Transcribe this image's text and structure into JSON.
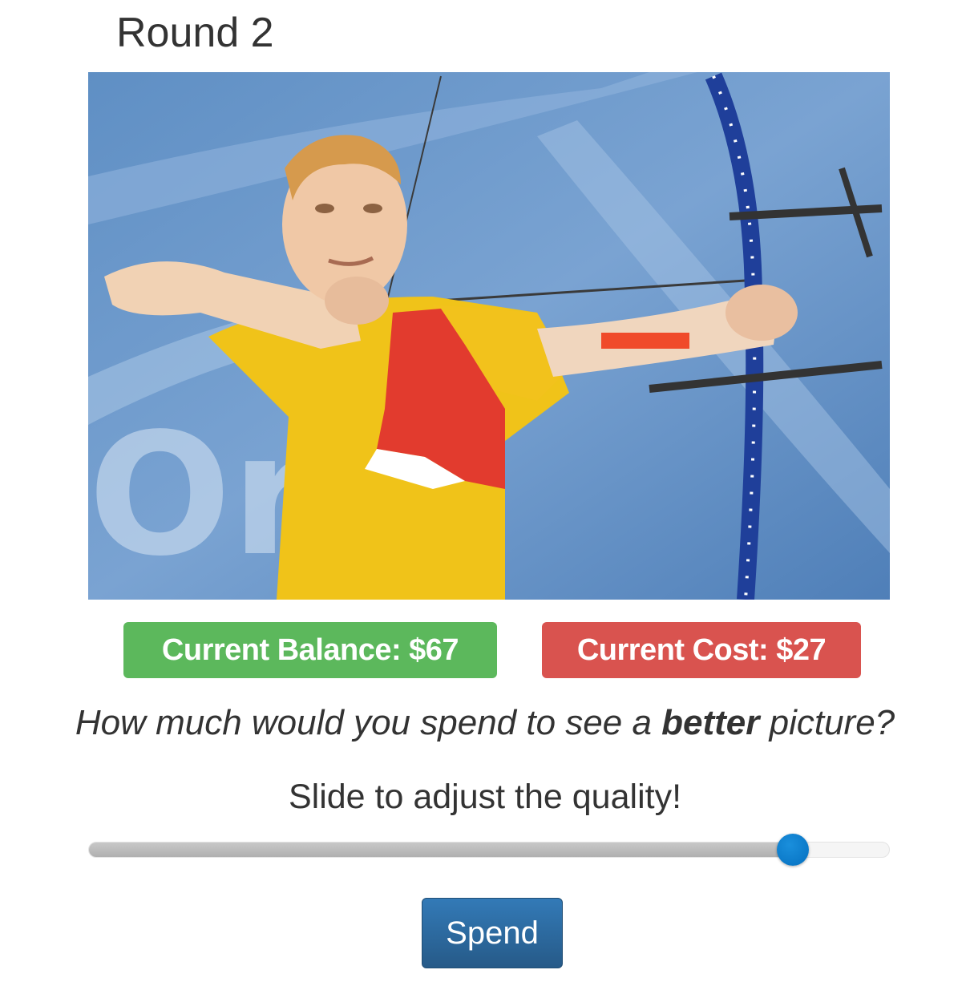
{
  "round": {
    "title": "Round 2"
  },
  "image": {
    "alt": "archer drawing bow"
  },
  "balance": {
    "label": "Current Balance: $67"
  },
  "cost": {
    "label": "Current Cost: $27"
  },
  "question": {
    "before": "How much would you spend to see a ",
    "emphasis": "better",
    "after": " picture?"
  },
  "instruction": {
    "text": "Slide to adjust the quality!"
  },
  "slider": {
    "value_percent": 88
  },
  "spend_button": {
    "label": "Spend"
  },
  "colors": {
    "balance_badge": "#5cb85c",
    "cost_badge": "#d9534f",
    "spend_button": "#337ab7",
    "slider_handle": "#0a7bd0"
  },
  "icons": {
    "slider_handle": "circle-knob"
  }
}
